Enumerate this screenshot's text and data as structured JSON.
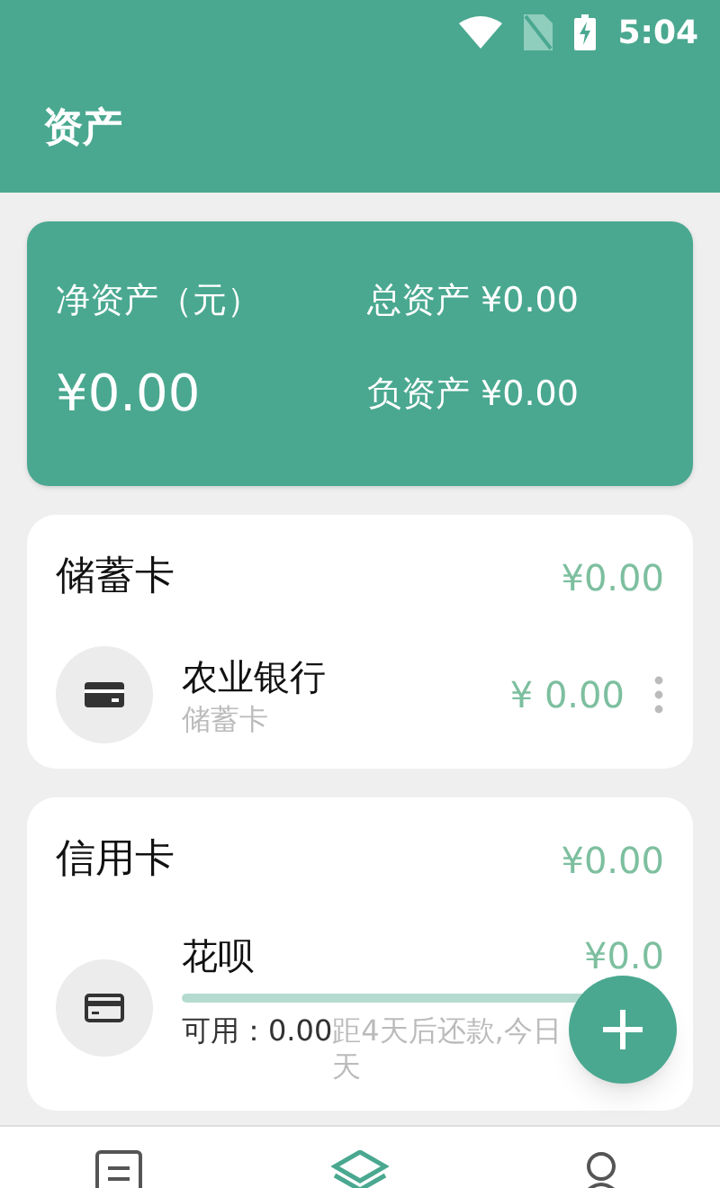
{
  "status_bar": {
    "time": "5:04"
  },
  "app_bar": {
    "title": "资产"
  },
  "summary": {
    "net_label": "净资产（元）",
    "net_value": "¥0.00",
    "total": "总资产 ¥0.00",
    "liabilities": "负资产 ¥0.00"
  },
  "groups": [
    {
      "kind": "debit",
      "title": "储蓄卡",
      "total": "¥0.00",
      "accounts": [
        {
          "name": "农业银行",
          "type": "储蓄卡",
          "balance": "¥ 0.00"
        }
      ]
    },
    {
      "kind": "credit",
      "title": "信用卡",
      "total": "¥0.00",
      "accounts": [
        {
          "name": "花呗",
          "balance": "¥0.0",
          "available": "可用：0.00",
          "due_note_line_1": "距4天后还款,今日",
          "due_note_line_2": "天"
        }
      ]
    }
  ],
  "bottom_nav": [
    {
      "selected": false
    },
    {
      "selected": true
    },
    {
      "selected": false
    }
  ]
}
